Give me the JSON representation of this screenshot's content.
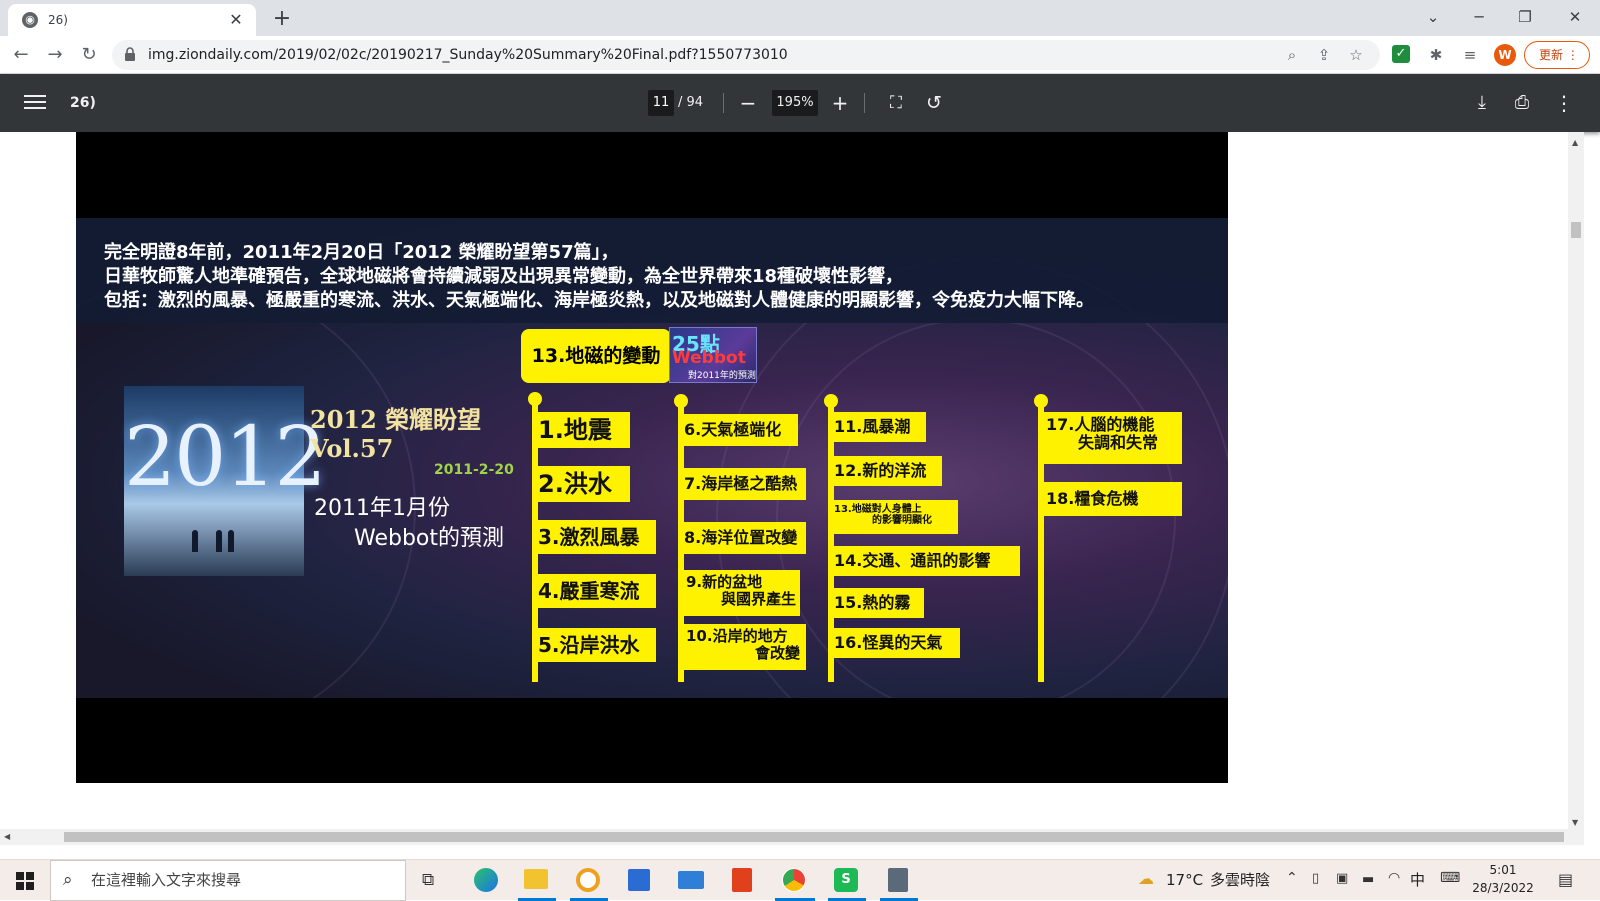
{
  "tab": {
    "title": "26)",
    "favicon": "globe-icon"
  },
  "address": {
    "url": "img.ziondaily.com/2019/02/02c/20190217_Sunday%20Summary%20Final.pdf?1550773010"
  },
  "profile": {
    "initial": "W"
  },
  "update_label": "更新",
  "pdf": {
    "title": "26)",
    "page_current": "11",
    "page_total": "/ 94",
    "zoom": "195%"
  },
  "slide": {
    "caption": [
      "完全明證8年前，2011年2月20日「2012 榮耀盼望第57篇」，",
      "日華牧師驚人地準確預告，全球地磁將會持續減弱及出現異常變動，為全世界帶來18種破壞性影響，",
      "包括：激烈的風暴、極嚴重的寒流、洪水、天氣極端化、海岸極炎熱，以及地磁對人體健康的明顯影響，令免疫力大幅下降。"
    ],
    "logo": {
      "year": "2012",
      "title": "2012 榮耀盼望",
      "vol": "Vol.57",
      "date": "2011-2-20",
      "sub1": "2011年1月份",
      "sub2": "Webbot的預測"
    },
    "topic": "13.地磁的變動",
    "badge": {
      "line1": "25點",
      "line2": "Webbot",
      "line3": "對2011年的預測"
    },
    "col1": [
      "1.地震",
      "2.洪水",
      "3.激烈風暴",
      "4.嚴重寒流",
      "5.沿岸洪水"
    ],
    "col2": [
      "6.天氣極端化",
      "7.海岸極之酷熱",
      "8.海洋位置改變",
      "9.新的盆地",
      "與國界產生",
      "10.沿岸的地方",
      "會改變"
    ],
    "col3": [
      "11.風暴潮",
      "12.新的洋流",
      "13.地磁對人身體上",
      "的影響明顯化",
      "14.交通、通訊的影響",
      "15.熱的霧",
      "16.怪異的天氣"
    ],
    "col4": [
      "17.人腦的機能",
      "失調和失常",
      "18.糧食危機"
    ]
  },
  "taskbar": {
    "search_placeholder": "在這裡輸入文字來搜尋",
    "weather_temp": "17°C",
    "weather_text": "多雲時陰",
    "ime": "中",
    "time": "5:01",
    "date": "28/3/2022"
  },
  "colors": {
    "accent_yellow": "#fff200",
    "pdf_toolbar": "#323639",
    "update_orange": "#e8590c"
  }
}
